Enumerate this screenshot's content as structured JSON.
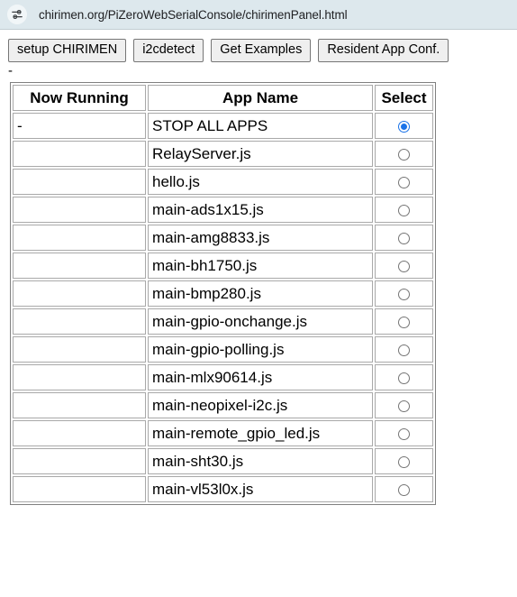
{
  "browser": {
    "url": "chirimen.org/PiZeroWebSerialConsole/chirimenPanel.html",
    "site_settings_icon": "tune-sliders-icon"
  },
  "toolbar": {
    "buttons": [
      {
        "label": "setup CHIRIMEN",
        "name": "setup-chirimen-button"
      },
      {
        "label": "i2cdetect",
        "name": "i2cdetect-button"
      },
      {
        "label": "Get Examples",
        "name": "get-examples-button"
      },
      {
        "label": "Resident App Conf.",
        "name": "resident-app-conf-button"
      }
    ]
  },
  "status": {
    "text": "-"
  },
  "table": {
    "headers": {
      "now_running": "Now Running",
      "app_name": "App Name",
      "select": "Select"
    },
    "rows": [
      {
        "running": "-",
        "app": "STOP ALL APPS",
        "selected": true
      },
      {
        "running": "",
        "app": "RelayServer.js",
        "selected": false
      },
      {
        "running": "",
        "app": "hello.js",
        "selected": false
      },
      {
        "running": "",
        "app": "main-ads1x15.js",
        "selected": false
      },
      {
        "running": "",
        "app": "main-amg8833.js",
        "selected": false
      },
      {
        "running": "",
        "app": "main-bh1750.js",
        "selected": false
      },
      {
        "running": "",
        "app": "main-bmp280.js",
        "selected": false
      },
      {
        "running": "",
        "app": "main-gpio-onchange.js",
        "selected": false
      },
      {
        "running": "",
        "app": "main-gpio-polling.js",
        "selected": false
      },
      {
        "running": "",
        "app": "main-mlx90614.js",
        "selected": false
      },
      {
        "running": "",
        "app": "main-neopixel-i2c.js",
        "selected": false
      },
      {
        "running": "",
        "app": "main-remote_gpio_led.js",
        "selected": false
      },
      {
        "running": "",
        "app": "main-sht30.js",
        "selected": false
      },
      {
        "running": "",
        "app": "main-vl53l0x.js",
        "selected": false
      }
    ]
  },
  "colors": {
    "urlbar_background": "#dde8ed",
    "radio_selected": "#1b73e8",
    "button_background": "#efefef",
    "page_background": "#ffffff"
  }
}
